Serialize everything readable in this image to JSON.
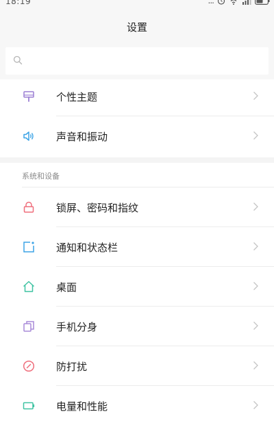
{
  "status_bar": {
    "time": "18:19",
    "more_dots": "...",
    "alarm_icon": "alarm-icon",
    "wifi_icon": "wifi-icon",
    "signal_icon": "signal-icon",
    "battery_icon": "battery-icon"
  },
  "header": {
    "title": "设置"
  },
  "search": {
    "icon": "search-icon",
    "placeholder": "",
    "value": ""
  },
  "groups": [
    {
      "header": "",
      "items": [
        {
          "label": "个性主题",
          "icon": "theme-icon",
          "color": "#9b7fd4"
        },
        {
          "label": "声音和振动",
          "icon": "speaker-icon",
          "color": "#3ba3e6"
        }
      ]
    },
    {
      "header": "系统和设备",
      "items": [
        {
          "label": "锁屏、密码和指纹",
          "icon": "lock-icon",
          "color": "#ef6e7c"
        },
        {
          "label": "通知和状态栏",
          "icon": "notification-icon",
          "color": "#3ba3e6"
        },
        {
          "label": "桌面",
          "icon": "home-icon",
          "color": "#3fc3a2"
        },
        {
          "label": "手机分身",
          "icon": "dual-phone-icon",
          "color": "#a88ad8"
        },
        {
          "label": "防打扰",
          "icon": "do-not-disturb-icon",
          "color": "#ef6e7c"
        },
        {
          "label": "电量和性能",
          "icon": "battery-performance-icon",
          "color": "#3fc3a2"
        }
      ]
    }
  ],
  "colors": {
    "accent_purple": "#9b7fd4",
    "accent_blue": "#3ba3e6",
    "accent_red": "#ef6e7c",
    "accent_green": "#3fc3a2",
    "chevron": "#c4c4c4"
  }
}
